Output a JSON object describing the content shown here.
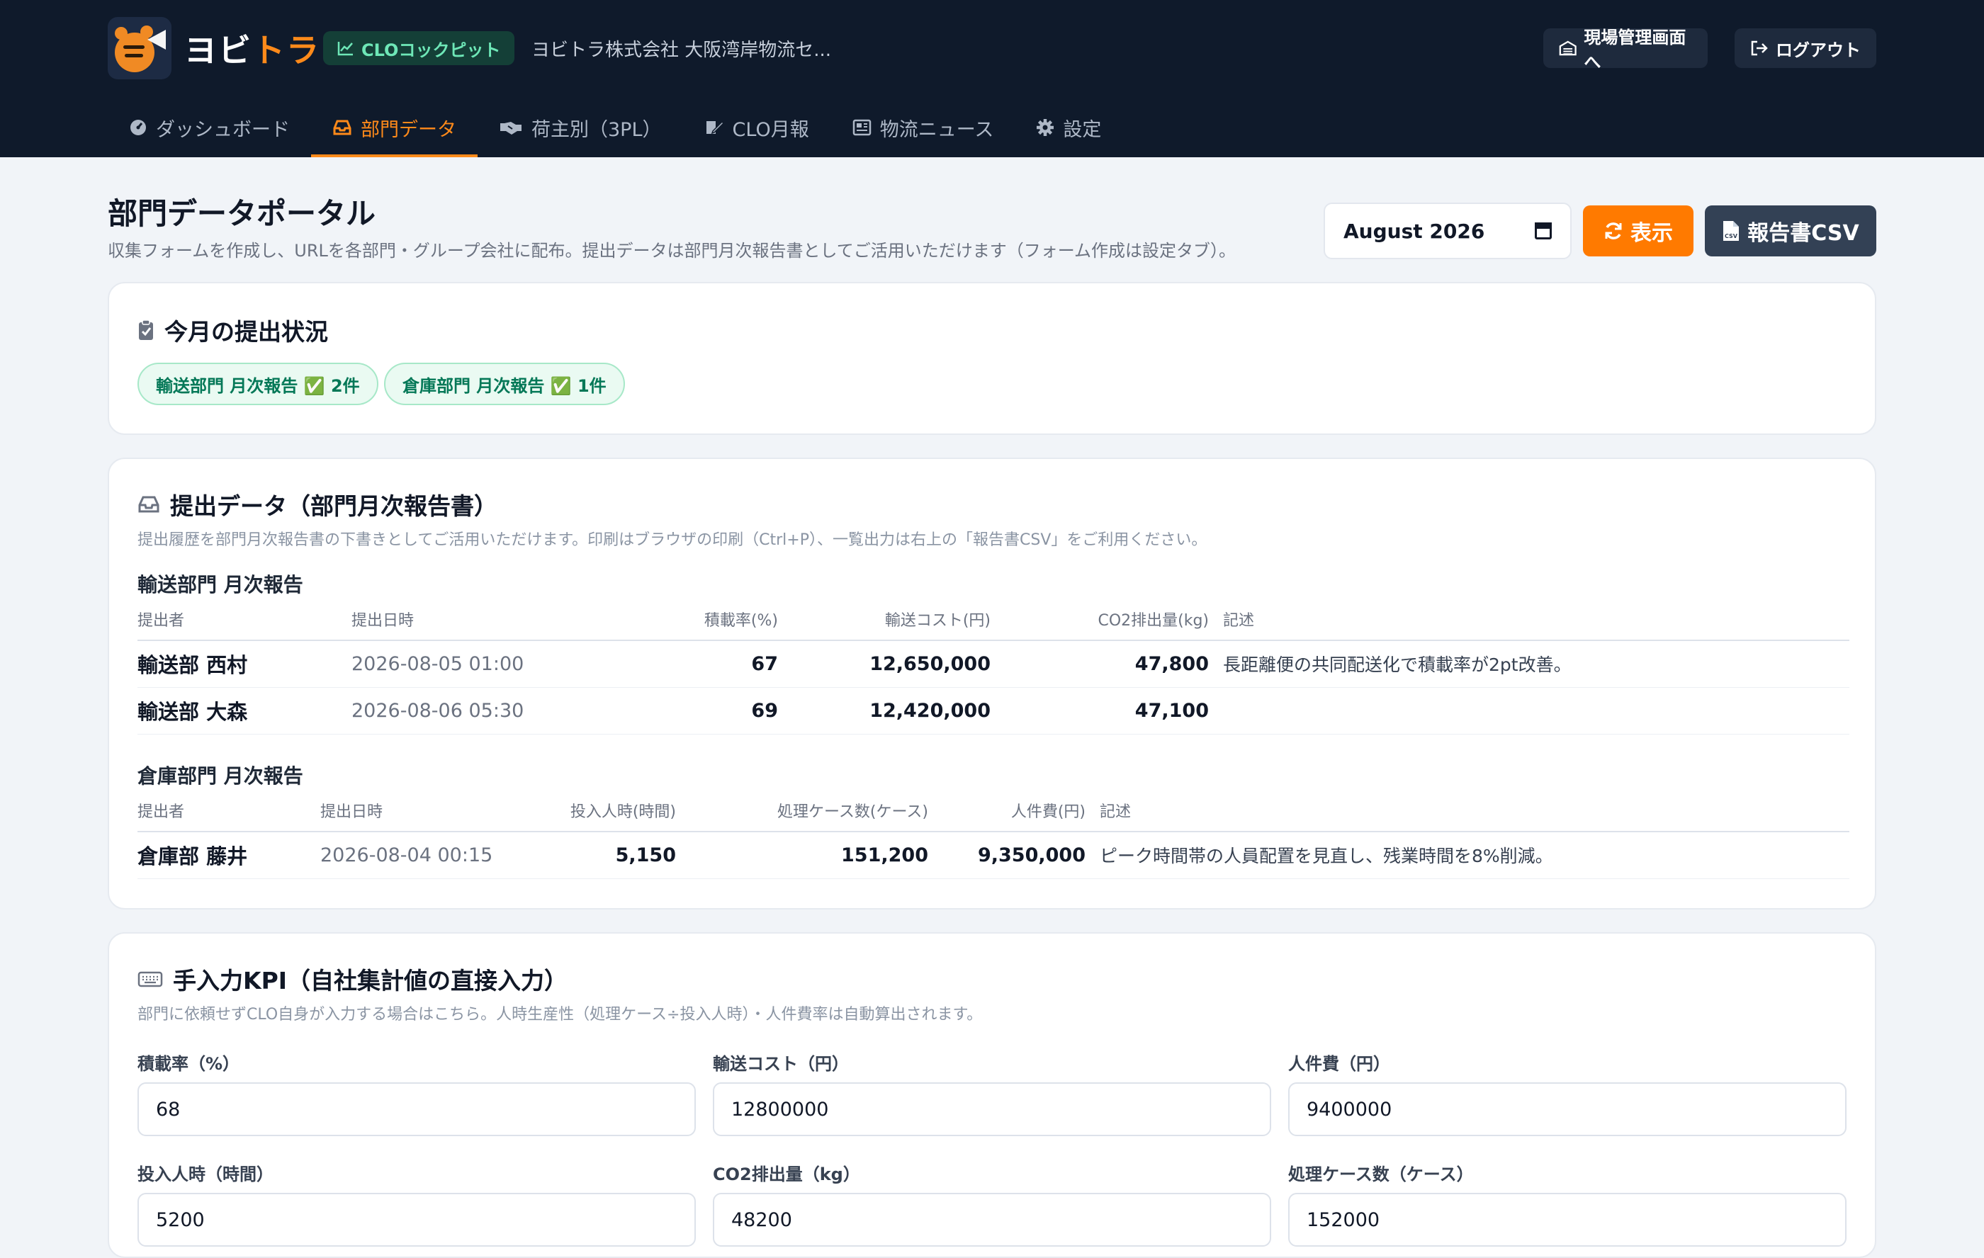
{
  "header": {
    "brand_a": "ヨビ",
    "brand_b": "トラ",
    "cockpit_badge": "CLOコックピット",
    "company": "ヨビトラ株式会社 大阪湾岸物流セ...",
    "site_button": "現場管理画面へ",
    "logout_button": "ログアウト"
  },
  "nav": {
    "tabs": [
      {
        "label": "ダッシュボード",
        "icon": "dashboard-icon"
      },
      {
        "label": "部門データ",
        "icon": "inbox-icon",
        "active": true
      },
      {
        "label": "荷主別（3PL）",
        "icon": "handshake-icon"
      },
      {
        "label": "CLO月報",
        "icon": "edit-icon"
      },
      {
        "label": "物流ニュース",
        "icon": "newspaper-icon"
      },
      {
        "label": "設定",
        "icon": "gear-icon"
      }
    ]
  },
  "page": {
    "title": "部門データポータル",
    "description": "収集フォームを作成し、URLを各部門・グループ会社に配布。提出データは部門月次報告書としてご活用いただけます（フォーム作成は設定タブ）。",
    "month_value": "August  2026",
    "show_button": "表示",
    "csv_button": "報告書CSV"
  },
  "status_card": {
    "title": "今月の提出状況",
    "pills": [
      "輸送部門 月次報告 ✅ 2件",
      "倉庫部門 月次報告 ✅ 1件"
    ]
  },
  "submissions": {
    "title": "提出データ（部門月次報告書）",
    "subtitle": "提出履歴を部門月次報告書の下書きとしてご活用いただけます。印刷はブラウザの印刷（Ctrl+P）、一覧出力は右上の「報告書CSV」をご利用ください。",
    "transport": {
      "title": "輸送部門 月次報告",
      "headers": [
        "提出者",
        "提出日時",
        "積載率(%)",
        "輸送コスト(円)",
        "CO2排出量(kg)",
        "記述"
      ],
      "rows": [
        [
          "輸送部 西村",
          "2026-08-05 01:00",
          "67",
          "12,650,000",
          "47,800",
          "長距離便の共同配送化で積載率が2pt改善。"
        ],
        [
          "輸送部 大森",
          "2026-08-06 05:30",
          "69",
          "12,420,000",
          "47,100",
          ""
        ]
      ]
    },
    "warehouse": {
      "title": "倉庫部門 月次報告",
      "headers": [
        "提出者",
        "提出日時",
        "投入人時(時間)",
        "処理ケース数(ケース)",
        "人件費(円)",
        "記述"
      ],
      "rows": [
        [
          "倉庫部 藤井",
          "2026-08-04 00:15",
          "5,150",
          "151,200",
          "9,350,000",
          "ピーク時間帯の人員配置を見直し、残業時間を8%削減。"
        ]
      ]
    }
  },
  "manual_kpi": {
    "title": "手入力KPI（自社集計値の直接入力）",
    "subtitle": "部門に依頼せずCLO自身が入力する場合はこちら。人時生産性（処理ケース÷投入人時）・人件費率は自動算出されます。",
    "fields": [
      {
        "label": "積載率（%）",
        "value": "68"
      },
      {
        "label": "輸送コスト（円）",
        "value": "12800000"
      },
      {
        "label": "人件費（円）",
        "value": "9400000"
      },
      {
        "label": "投入人時（時間）",
        "value": "5200"
      },
      {
        "label": "CO2排出量（kg）",
        "value": "48200"
      },
      {
        "label": "処理ケース数（ケース）",
        "value": "152000"
      }
    ]
  },
  "colors": {
    "header_bg": "#0f1a2b",
    "accent": "#ff7a00",
    "success": "#047857"
  }
}
